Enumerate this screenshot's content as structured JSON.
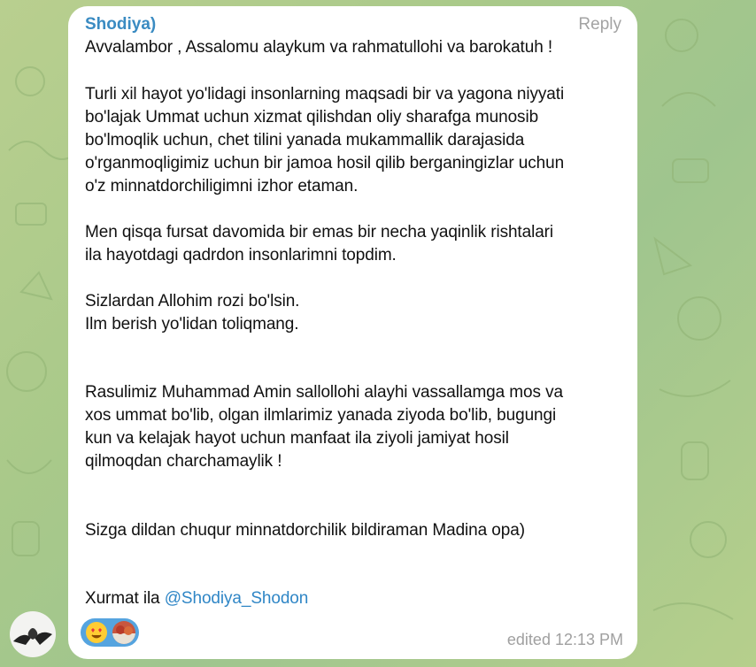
{
  "message": {
    "sender": "Shodiya)",
    "reply_label": "Reply",
    "lines": [
      "Avvalambor , Assalomu alaykum va rahmatullohi va barokatuh !",
      "Turli xil hayot yo'lidagi insonlarning maqsadi bir va yagona niyyati",
      "bo'lajak Ummat uchun xizmat qilishdan oliy sharafga munosib",
      "bo'lmoqlik uchun, chet tilini yanada mukammallik darajasida",
      "o'rganmoqligimiz uchun bir jamoa hosil qilib berganingizlar uchun",
      "o'z minnatdorchiligimni izhor etaman.",
      "Men qisqa fursat davomida bir emas bir necha yaqinlik rishtalari",
      "ila hayotdagi qadrdon insonlarimni topdim.",
      "Sizlardan Allohim rozi bo'lsin.",
      "Ilm berish yo'lidan toliqmang.",
      "Rasulimiz Muhammad Amin sallollohi alayhi vassallamga mos va",
      "xos ummat bo'lib, olgan ilmlarimiz yanada ziyoda bo'lib, bugungi",
      "kun va kelajak hayot uchun manfaat ila  ziyoli jamiyat hosil",
      "qilmoqdan charchamaylik !",
      "Sizga dildan chuqur minnatdorchilik bildiraman Madina opa)"
    ],
    "signature_prefix": "Xurmat ila ",
    "signature_mention": "@Shodiya_Shodon",
    "edited_label": "edited 12:13 PM"
  },
  "reactions": {
    "emoji_icon": "heart-eyes-emoji-icon",
    "avatar_icon": "reactor-avatar"
  },
  "colors": {
    "sender": "#3a8bc2",
    "mention": "#2f86c6",
    "reaction_pill": "#55a4df",
    "chat_background": "#a9c98a"
  }
}
